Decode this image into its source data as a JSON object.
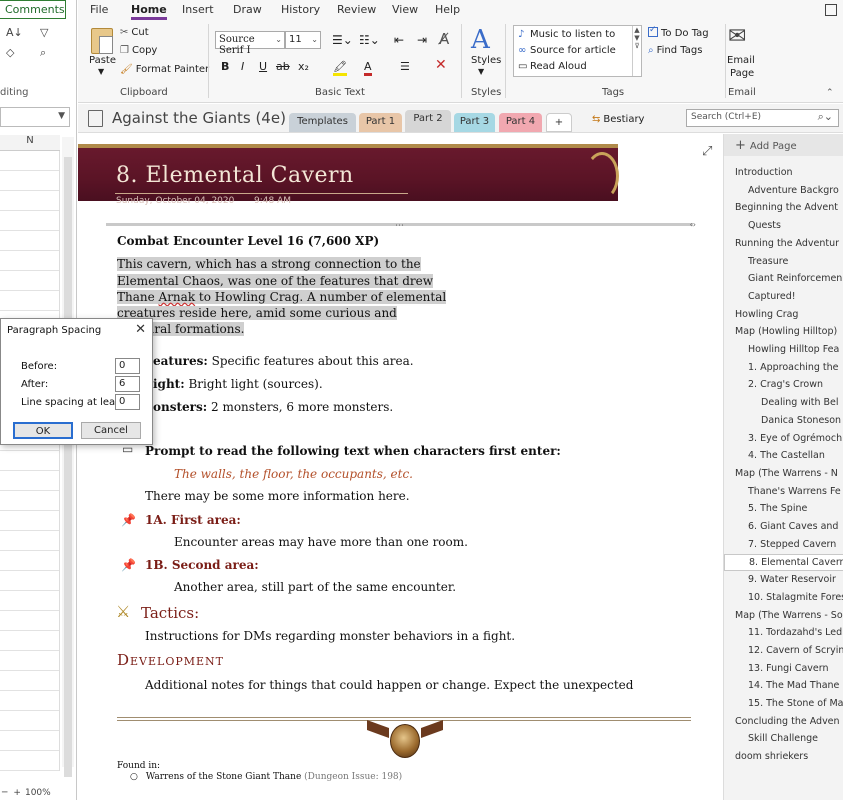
{
  "excel": {
    "comments_label": "Comments",
    "editing_label": "diting",
    "col_header": "N",
    "zoom": "100%"
  },
  "ribbon": {
    "tabs": [
      "File",
      "Home",
      "Insert",
      "Draw",
      "History",
      "Review",
      "View",
      "Help"
    ],
    "clipboard": {
      "paste": "Paste",
      "cut": "Cut",
      "copy": "Copy",
      "format_painter": "Format Painter",
      "group_label": "Clipboard"
    },
    "basic_text": {
      "font_name": "Source Serif I",
      "font_size": "11",
      "group_label": "Basic Text"
    },
    "styles": {
      "label": "Styles",
      "group_label": "Styles"
    },
    "tags": {
      "items": [
        "Music to listen to",
        "Source for article",
        "Read Aloud"
      ],
      "to_do": "To Do Tag",
      "find": "Find Tags",
      "group_label": "Tags"
    },
    "email": {
      "label1": "Email",
      "label2": "Page",
      "group_label": "Email"
    }
  },
  "notebook": {
    "title": "Against the Giants (4e)",
    "sections": [
      {
        "label": "Templates",
        "color": "#c9d1d8"
      },
      {
        "label": "Part 1",
        "color": "#e8c6a8"
      },
      {
        "label": "Part 2",
        "color": "#d6d6d6"
      },
      {
        "label": "Part 3",
        "color": "#a6d8e4"
      },
      {
        "label": "Part 4",
        "color": "#f1a8b0"
      },
      {
        "label": "+",
        "color": "#ffffff"
      }
    ],
    "bestiary": "Bestiary",
    "search_placeholder": "Search (Ctrl+E)"
  },
  "page": {
    "title": "8. Elemental Cavern",
    "date": "Sunday, October 04, 2020",
    "time": "9:48 AM",
    "encounter": "Combat Encounter Level 16 (7,600 XP)",
    "intro_lines": [
      "This cavern, which has a strong connection to the",
      "Elemental Chaos, was one of the features that drew",
      "Thane Arnak to Howling Crag. A number of elemental",
      "creatures reside here, amid some curious and",
      "s natural formations."
    ],
    "features_label": "eatures:",
    "features_text": "Specific features about this area.",
    "light_label": "ight:",
    "light_text": "Bright light (sources).",
    "monsters_label": "onsters:",
    "monsters_text": "2 monsters, 6 more monsters.",
    "prompt": "Prompt to read the following text when characters first enter:",
    "read_aloud": "The walls, the floor, the occupants, etc.",
    "more_info": "There may be some more information here.",
    "area1_title": "1A. First area:",
    "area1_text": "Encounter areas may have more than one room.",
    "area2_title": "1B. Second area:",
    "area2_text": "Another area, still part of the same encounter.",
    "tactics_title": "Tactics:",
    "tactics_text": "Instructions for DMs regarding monster behaviors in a fight.",
    "development_title": "Development",
    "development_text": "Additional notes for things that could happen or change. Expect the unexpected",
    "found_in": "Found in:",
    "source": "Warrens of the Stone Giant Thane",
    "source_note": "(Dungeon Issue: 198)"
  },
  "dialog": {
    "title": "Paragraph Spacing",
    "before_label": "Before:",
    "before_value": "0",
    "after_label": "After:",
    "after_value": "6",
    "line_label": "Line spacing at least:",
    "line_value": "0",
    "ok": "OK",
    "cancel": "Cancel"
  },
  "pagelist": {
    "add_page": "Add Page",
    "items": [
      {
        "label": "Introduction",
        "indent": 0
      },
      {
        "label": "Adventure Backgro",
        "indent": 1
      },
      {
        "label": "Beginning the Advent",
        "indent": 0
      },
      {
        "label": "Quests",
        "indent": 1
      },
      {
        "label": "Running the Adventur",
        "indent": 0
      },
      {
        "label": "Treasure",
        "indent": 1
      },
      {
        "label": "Giant Reinforcemen",
        "indent": 1
      },
      {
        "label": "Captured!",
        "indent": 1
      },
      {
        "label": "Howling Crag",
        "indent": 0
      },
      {
        "label": "Map (Howling Hilltop)",
        "indent": 0
      },
      {
        "label": "Howling Hilltop Fea",
        "indent": 1
      },
      {
        "label": "1. Approaching the",
        "indent": 1
      },
      {
        "label": "2. Crag's Crown",
        "indent": 1
      },
      {
        "label": "Dealing with Bel",
        "indent": 2
      },
      {
        "label": "Danica Stoneson",
        "indent": 2
      },
      {
        "label": "3. Eye of Ogrémoch",
        "indent": 1
      },
      {
        "label": "4. The Castellan",
        "indent": 1
      },
      {
        "label": "Map (The Warrens - N",
        "indent": 0
      },
      {
        "label": "Thane's Warrens Fe",
        "indent": 1
      },
      {
        "label": "5. The Spine",
        "indent": 1
      },
      {
        "label": "6. Giant Caves and",
        "indent": 1
      },
      {
        "label": "7. Stepped Cavern",
        "indent": 1
      },
      {
        "label": "8. Elemental Cavern",
        "indent": 1,
        "selected": true
      },
      {
        "label": "9. Water Reservoir",
        "indent": 1
      },
      {
        "label": "10. Stalagmite Fores",
        "indent": 1
      },
      {
        "label": "Map (The Warrens - So",
        "indent": 0
      },
      {
        "label": "11. Tordazahd's Led",
        "indent": 1
      },
      {
        "label": "12. Cavern of Scryin",
        "indent": 1
      },
      {
        "label": "13. Fungi Cavern",
        "indent": 1
      },
      {
        "label": "14. The Mad Thane",
        "indent": 1
      },
      {
        "label": "15. The Stone of Ma",
        "indent": 1
      },
      {
        "label": "Concluding the Adven",
        "indent": 0
      },
      {
        "label": "Skill Challenge",
        "indent": 1
      },
      {
        "label": "doom shriekers",
        "indent": 0
      }
    ]
  }
}
